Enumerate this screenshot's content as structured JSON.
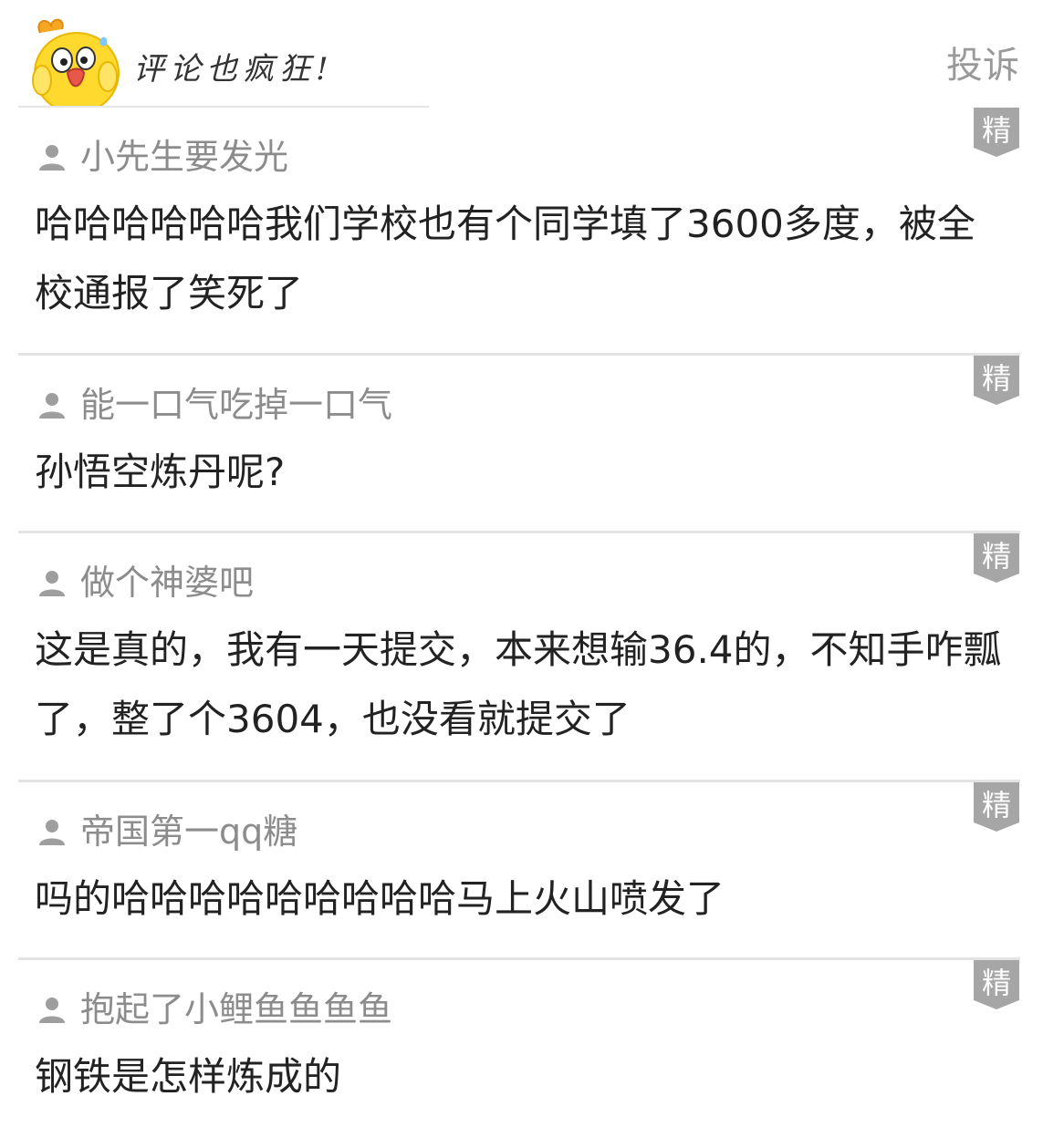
{
  "header": {
    "title": "评论也疯狂!",
    "complaint_label": "投诉",
    "mascot_icon": "yellow-chick-mascot"
  },
  "badge_label": "精",
  "user_icon": "person-silhouette-icon",
  "comments": [
    {
      "username": "小先生要发光",
      "text": "哈哈哈哈哈哈我们学校也有个同学填了3600多度，被全校通报了笑死了"
    },
    {
      "username": "能一口气吃掉一口气",
      "text": "孙悟空炼丹呢?"
    },
    {
      "username": "做个神婆吧",
      "text": "这是真的，我有一天提交，本来想输36.4的，不知手咋瓢了，整了个3604，也没看就提交了"
    },
    {
      "username": "帝国第一qq糖",
      "text": "吗的哈哈哈哈哈哈哈哈哈马上火山喷发了"
    },
    {
      "username": "抱起了小鲤鱼鱼鱼鱼",
      "text": "钢铁是怎样炼成的"
    }
  ],
  "colors": {
    "username": "#8c8c8c",
    "comment_text": "#222222",
    "badge": "#a6a6a6",
    "divider": "#e3e3e3",
    "mascot": "#ffd92e"
  }
}
